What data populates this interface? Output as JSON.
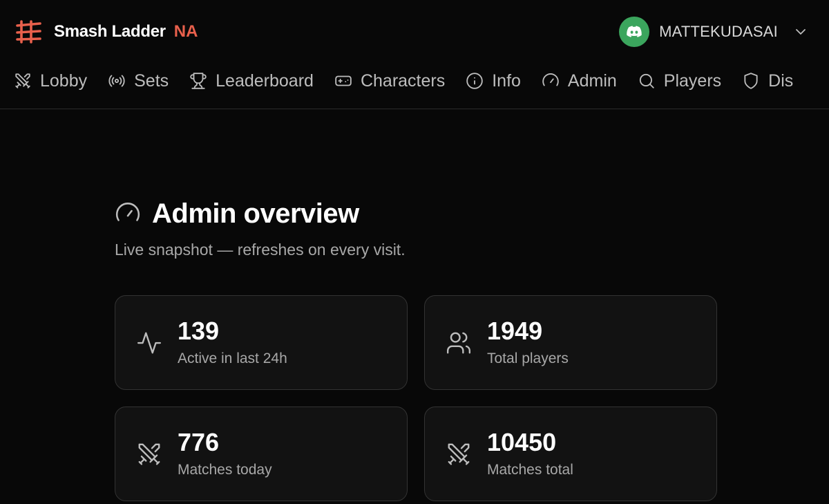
{
  "brand": {
    "name": "Smash Ladder",
    "region": "NA",
    "accent": "#e8604c"
  },
  "user": {
    "name": "MATTEKUDASAI",
    "avatar_icon": "discord-icon",
    "avatar_color": "#3ba55d"
  },
  "nav": {
    "items": [
      {
        "label": "Lobby",
        "icon": "crossed-swords-icon"
      },
      {
        "label": "Sets",
        "icon": "broadcast-icon"
      },
      {
        "label": "Leaderboard",
        "icon": "trophy-icon"
      },
      {
        "label": "Characters",
        "icon": "gamepad-icon"
      },
      {
        "label": "Info",
        "icon": "info-icon"
      },
      {
        "label": "Admin",
        "icon": "gauge-icon"
      },
      {
        "label": "Players",
        "icon": "search-icon"
      },
      {
        "label": "Dis",
        "icon": "shield-icon"
      }
    ]
  },
  "page": {
    "title": "Admin overview",
    "title_icon": "gauge-icon",
    "subtitle": "Live snapshot — refreshes on every visit."
  },
  "stats": [
    {
      "value": "139",
      "label": "Active in last 24h",
      "icon": "activity-icon"
    },
    {
      "value": "1949",
      "label": "Total players",
      "icon": "users-icon"
    },
    {
      "value": "776",
      "label": "Matches today",
      "icon": "crossed-swords-icon"
    },
    {
      "value": "10450",
      "label": "Matches total",
      "icon": "crossed-swords-icon"
    }
  ]
}
